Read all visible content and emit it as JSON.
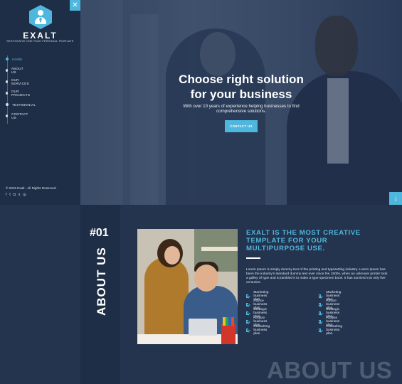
{
  "brand": {
    "name": "EXALT",
    "tagline": "RESPONSIVE ONE PAGE PERSONAL TEMPLATE"
  },
  "sidebar": {
    "close_icon": "close-icon",
    "items": [
      {
        "label": "HOME",
        "active": true
      },
      {
        "label": "ABOUT US",
        "active": false
      },
      {
        "label": "OUR SERVICES",
        "active": false
      },
      {
        "label": "OUR PROJECTS",
        "active": false
      },
      {
        "label": "TESTIMONIAL",
        "active": false
      },
      {
        "label": "CONTACT US",
        "active": false
      }
    ],
    "copyright": "© 2016 Exalt - All Rights Reserved",
    "socials": [
      "facebook-icon",
      "twitter-icon",
      "instagram-icon",
      "skype-icon",
      "dribbble-icon"
    ]
  },
  "hero": {
    "title_line1": "Choose right solution",
    "title_line2": "for your business",
    "subtitle": "With over 10 years of experience helping businesses to find comprehensive solutions.",
    "cta_label": "CONTACT US"
  },
  "about": {
    "number": "#01",
    "vertical_title": "ABOUT US",
    "headline": "EXALT IS THE MOST CREATIVE TEMPLATE FOR YOUR MULTIPURPOSE USE.",
    "description": "Lorem Ipsum is simply dummy text of the printing and typesetting industry. Lorem Ipsum has been the industry's standard dummy text ever since the 1500s, when an unknown printer took a galley of type and scrambled it to make a type specimen book. It has survived not only five centuries.",
    "features_left": [
      "Marketing business plan",
      "Advice business plan",
      "Strategic business plan",
      "Analize business plan",
      "Consulting business plan"
    ],
    "features_right": [
      "Marketing business plan",
      "Advice business plan",
      "Strategic business plan",
      "Analize business plan",
      "Consulting business plan"
    ],
    "watermark": "ABOUT US"
  },
  "colors": {
    "accent": "#4fb7dd",
    "sidebar_bg": "#1f2e47",
    "page_bg": "#24344f"
  }
}
